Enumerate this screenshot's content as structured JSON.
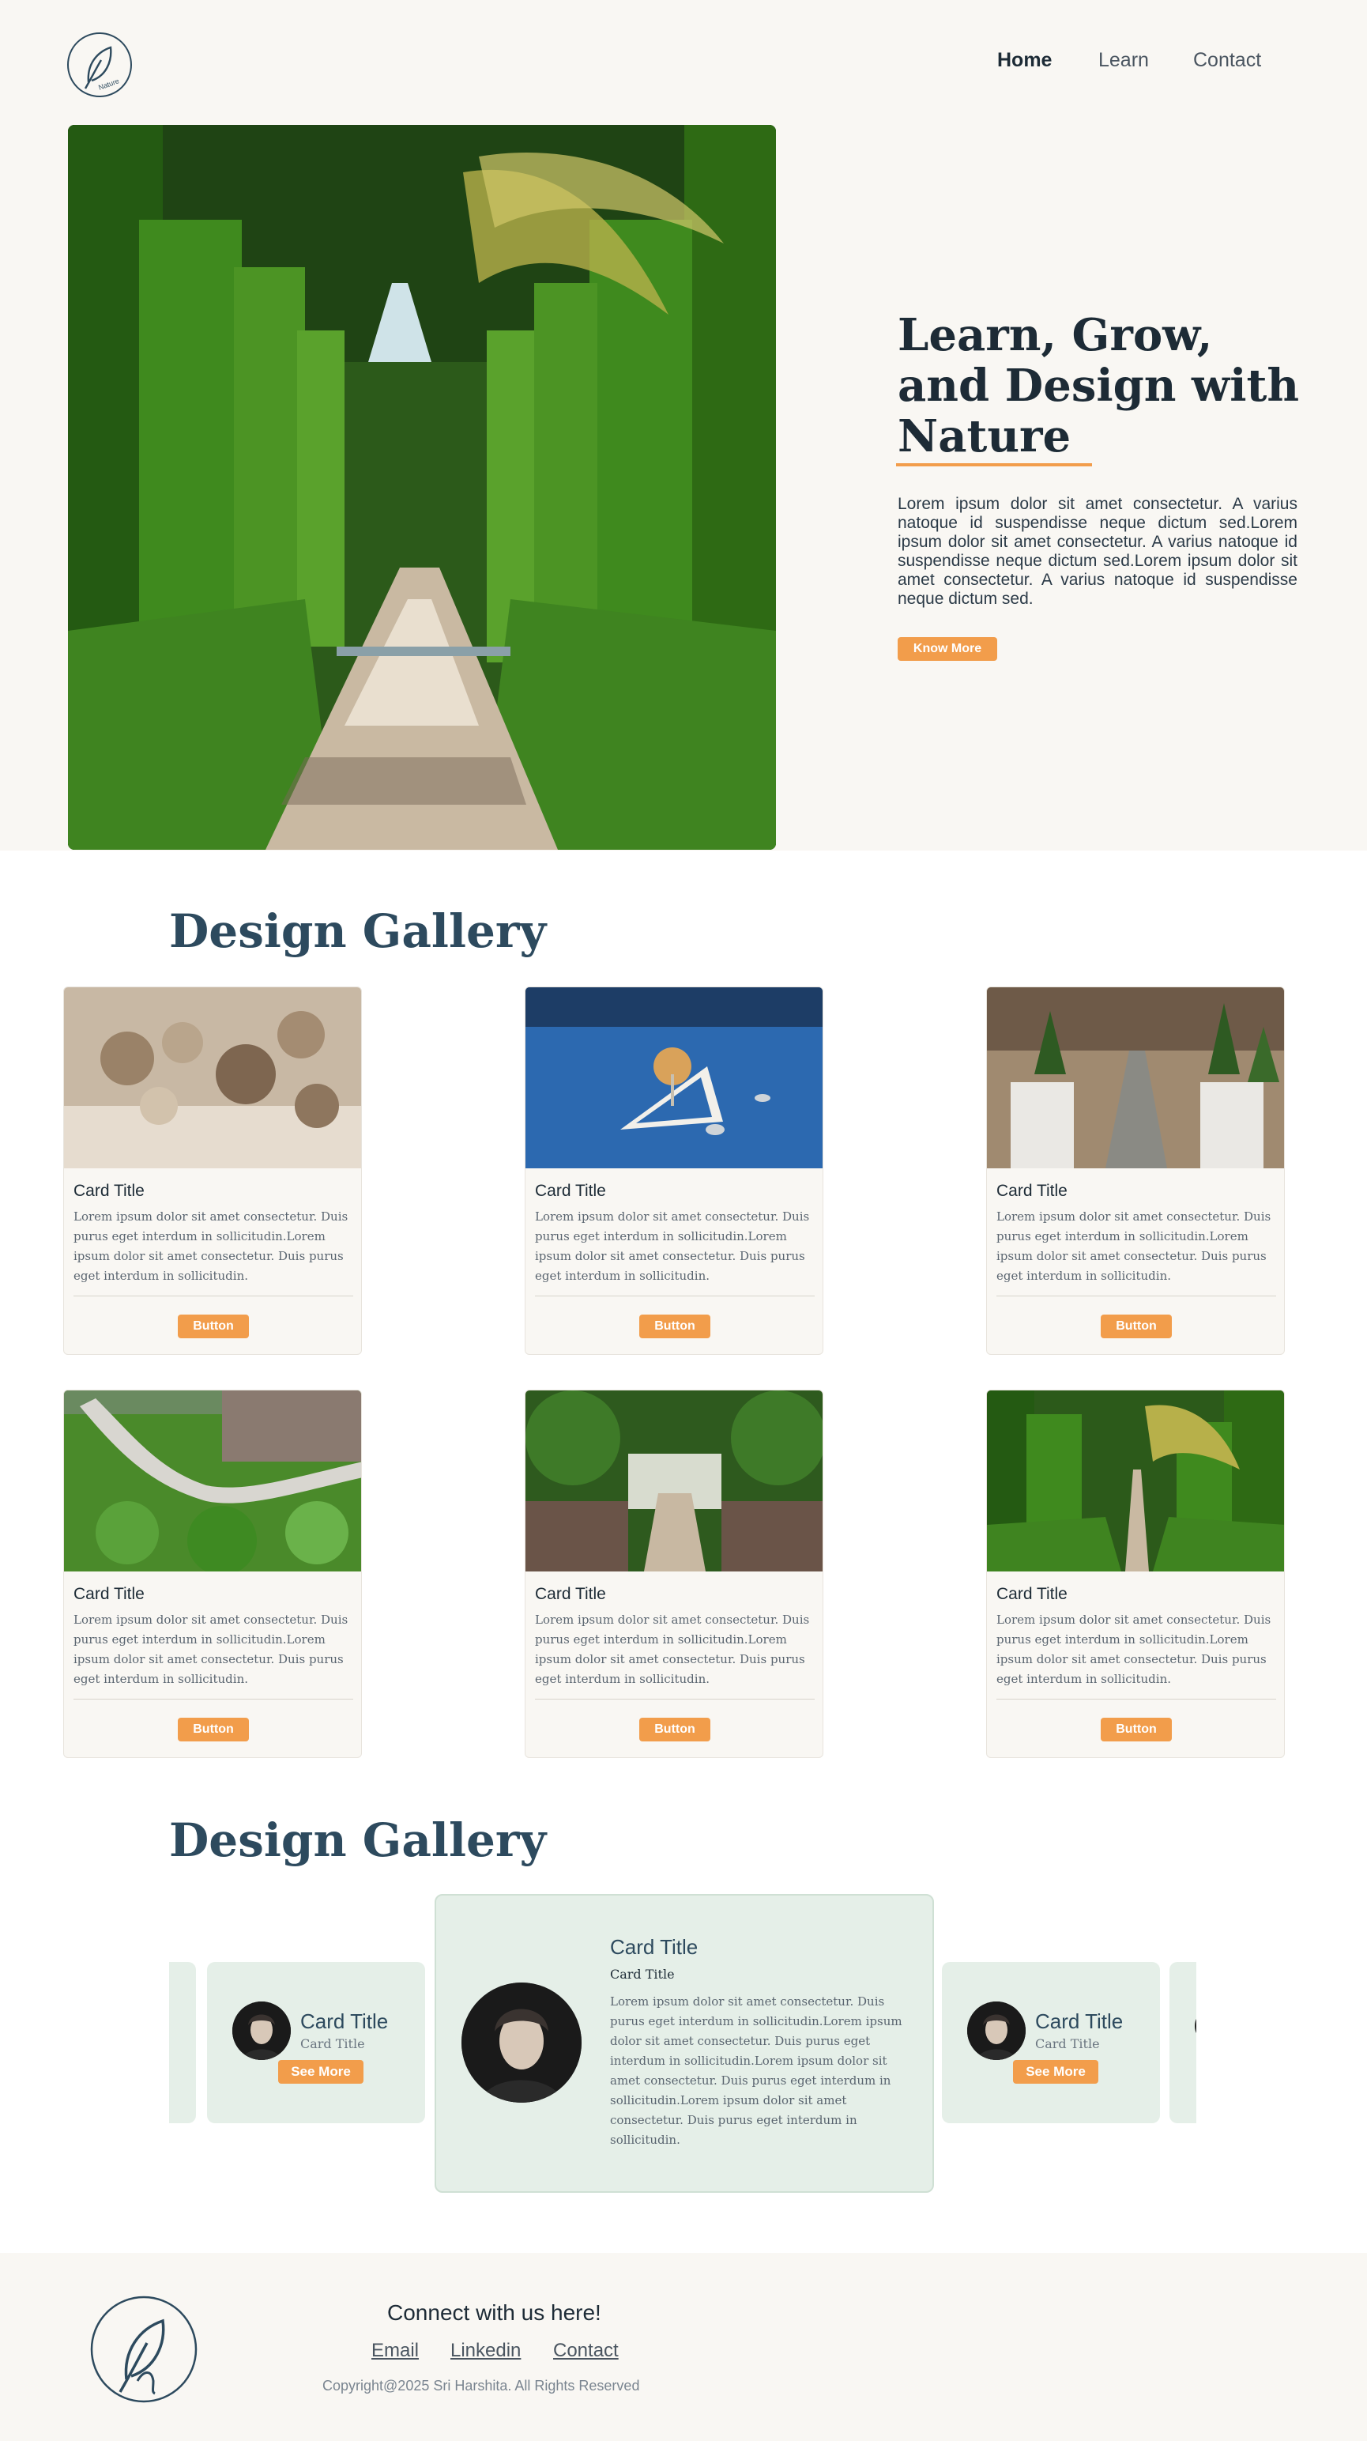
{
  "header": {
    "logo_text": "Nature",
    "nav": [
      {
        "label": "Home",
        "active": true
      },
      {
        "label": "Learn",
        "active": false
      },
      {
        "label": "Contact",
        "active": false
      }
    ]
  },
  "hero": {
    "image": "garden-path-hedges-palm-photo",
    "title": "Learn, Grow, and Design with Nature",
    "text": "Lorem ipsum dolor sit amet consectetur. A varius natoque id suspendisse neque dictum sed.Lorem ipsum dolor sit amet consectetur. A varius natoque id suspendisse neque dictum sed.Lorem ipsum dolor sit amet consectetur. A varius natoque id suspendisse neque dictum sed.",
    "button": "Know More"
  },
  "gallery": {
    "title": "Design Gallery",
    "cards": [
      {
        "image": "architecture-model-trees",
        "title": "Card Title",
        "desc": "Lorem ipsum dolor sit amet consectetur. Duis purus eget interdum in sollicitudin.Lorem ipsum dolor sit amet consectetur. Duis purus eget interdum in sollicitudin.",
        "button": "Button"
      },
      {
        "image": "blue-tree-island-model",
        "title": "Card Title",
        "desc": "Lorem ipsum dolor sit amet consectetur. Duis purus eget interdum in sollicitudin.Lorem ipsum dolor sit amet consectetur. Duis purus eget interdum in sollicitudin.",
        "button": "Button"
      },
      {
        "image": "white-blocks-model-path",
        "title": "Card Title",
        "desc": "Lorem ipsum dolor sit amet consectetur. Duis purus eget interdum in sollicitudin.Lorem ipsum dolor sit amet consectetur. Duis purus eget interdum in sollicitudin.",
        "button": "Button"
      },
      {
        "image": "aerial-green-garden",
        "title": "Card Title",
        "desc": "Lorem ipsum dolor sit amet consectetur. Duis purus eget interdum in sollicitudin.Lorem ipsum dolor sit amet consectetur. Duis purus eget interdum in sollicitudin.",
        "button": "Button"
      },
      {
        "image": "park-stone-path",
        "title": "Card Title",
        "desc": "Lorem ipsum dolor sit amet consectetur. Duis purus eget interdum in sollicitudin.Lorem ipsum dolor sit amet consectetur. Duis purus eget interdum in sollicitudin.",
        "button": "Button"
      },
      {
        "image": "hedge-garden-path",
        "title": "Card Title",
        "desc": "Lorem ipsum dolor sit amet consectetur. Duis purus eget interdum in sollicitudin.Lorem ipsum dolor sit amet consectetur. Duis purus eget interdum in sollicitudin.",
        "button": "Button"
      }
    ]
  },
  "testimonials": {
    "title": "Design Gallery",
    "side_card": {
      "title": "Card Title",
      "subtitle": "Card Title",
      "button": "See More"
    },
    "main_card": {
      "title": "Card Title",
      "subtitle": "Card Title",
      "desc": "Lorem ipsum dolor sit amet consectetur. Duis purus eget interdum in sollicitudin.Lorem ipsum dolor sit amet consectetur. Duis purus eget interdum in sollicitudin.Lorem ipsum dolor sit amet consectetur. Duis purus eget interdum in sollicitudin.Lorem ipsum dolor sit amet consectetur. Duis purus eget interdum in sollicitudin."
    }
  },
  "footer": {
    "heading": "Connect with us here!",
    "links": [
      "Email",
      "Linkedin",
      "Contact"
    ],
    "copyright": "Copyright@2025 Sri Harshita. All Rights Reserved"
  },
  "colors": {
    "accent": "#f29d4b",
    "heading": "#2d4a5e",
    "card_bg": "#e5efe8",
    "band_bg": "#f9f7f3"
  }
}
